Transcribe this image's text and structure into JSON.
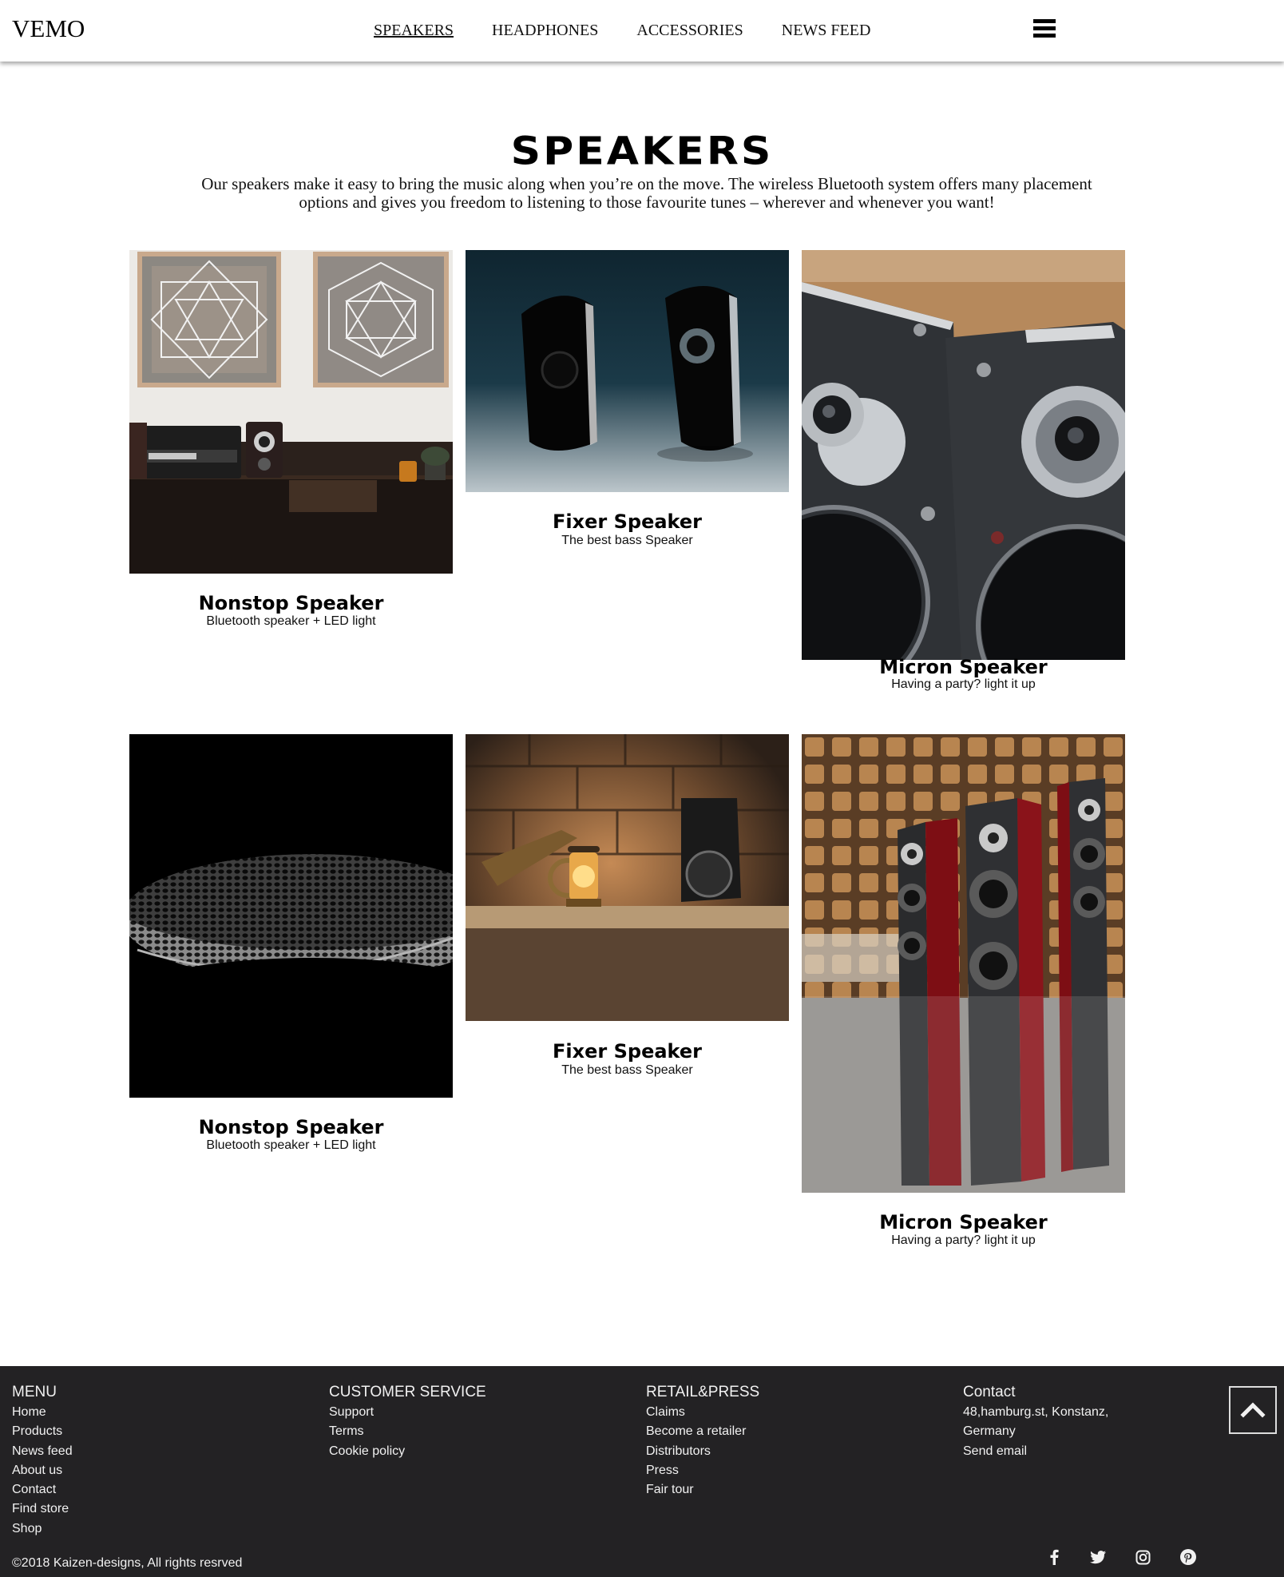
{
  "header": {
    "logo": "VEMO",
    "nav": [
      {
        "label": "SPEAKERS",
        "active": true
      },
      {
        "label": "HEADPHONES",
        "active": false
      },
      {
        "label": "ACCESSORIES",
        "active": false
      },
      {
        "label": "NEWS FEED",
        "active": false
      }
    ],
    "menu_icon": "hamburger-icon"
  },
  "intro": {
    "title": "SPEAKERS",
    "text": "Our speakers make it easy to bring the music along when you’re on the move. The wireless Bluetooth system offers many placement options and gives you freedom to listening to those favourite tunes – wherever and whenever you want!"
  },
  "products": [
    {
      "title": "Nonstop Speaker",
      "subtitle": "Bluetooth speaker + LED light",
      "image": "living-room-turntable-photo"
    },
    {
      "title": "Fixer Speaker",
      "subtitle": "The best bass Speaker",
      "image": "glossy-black-speakers-photo"
    },
    {
      "title": "Micron Speaker",
      "subtitle": "Having a party? light it up",
      "image": "audiovector-speakers-photo"
    },
    {
      "title": "Nonstop Speaker",
      "subtitle": "Bluetooth speaker + LED light",
      "image": "speaker-grille-macro-photo"
    },
    {
      "title": "Fixer Speaker",
      "subtitle": "The best bass Speaker",
      "image": "lantern-shelf-speaker-photo"
    },
    {
      "title": "Micron Speaker",
      "subtitle": "Having a party? light it up",
      "image": "red-tower-speakers-photo"
    }
  ],
  "footer": {
    "menu": {
      "heading": "MENU",
      "links": [
        "Home",
        "Products",
        "News feed",
        "About us",
        "Contact",
        "Find store",
        "Shop"
      ]
    },
    "customer_service": {
      "heading": "CUSTOMER SERVICE",
      "links": [
        "Support",
        "Terms",
        "Cookie policy"
      ]
    },
    "retail": {
      "heading": "RETAIL&PRESS",
      "links": [
        "Claims",
        "Become a retailer",
        "Distributors",
        "Press",
        "Fair tour"
      ]
    },
    "contact": {
      "heading": "Contact",
      "links": [
        "48,hamburg.st, Konstanz,",
        "Germany",
        "Send email"
      ]
    },
    "copyright": "©2018 Kaizen-designs, All rights resrved",
    "social_icons": [
      "facebook-icon",
      "twitter-icon",
      "instagram-icon",
      "pinterest-icon"
    ],
    "back_to_top_icon": "chevron-up-icon"
  },
  "colors": {
    "footer_bg": "#232224",
    "footer_text": "#f1f1f1",
    "text": "#000000"
  }
}
